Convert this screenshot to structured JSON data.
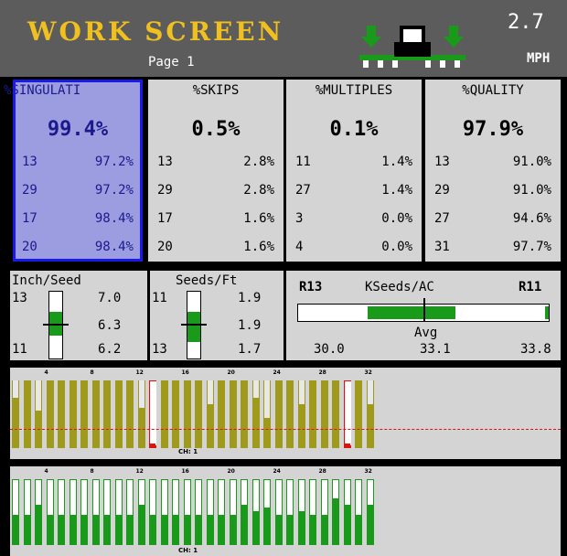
{
  "header": {
    "title": "WORK SCREEN",
    "page": "Page 1",
    "speed_value": "2.7",
    "speed_unit": "MPH",
    "tractor_icon": "tractor-planter-icon"
  },
  "metrics": [
    {
      "key": "singulation",
      "title": "%SINGULATI",
      "value": "99.4%",
      "rows": [
        [
          "13",
          "97.2%"
        ],
        [
          "29",
          "97.2%"
        ],
        [
          "17",
          "98.4%"
        ],
        [
          "20",
          "98.4%"
        ]
      ]
    },
    {
      "key": "skips",
      "title": "%SKIPS",
      "value": "0.5%",
      "rows": [
        [
          "13",
          "2.8%"
        ],
        [
          "29",
          "2.8%"
        ],
        [
          "17",
          "1.6%"
        ],
        [
          "20",
          "1.6%"
        ]
      ]
    },
    {
      "key": "multiples",
      "title": "%MULTIPLES",
      "value": "0.1%",
      "rows": [
        [
          "11",
          "1.4%"
        ],
        [
          "27",
          "1.4%"
        ],
        [
          "3",
          "0.0%"
        ],
        [
          "4",
          "0.0%"
        ]
      ]
    },
    {
      "key": "quality",
      "title": "%QUALITY",
      "value": "97.9%",
      "rows": [
        [
          "13",
          "91.0%"
        ],
        [
          "29",
          "91.0%"
        ],
        [
          "27",
          "94.6%"
        ],
        [
          "31",
          "97.7%"
        ]
      ]
    }
  ],
  "inch_seed": {
    "title": "Inch/Seed",
    "top_row": "13",
    "top_val": "7.0",
    "mid_val": "6.3",
    "bot_row": "11",
    "bot_val": "6.2",
    "fill_level": 0.35
  },
  "seeds_ft": {
    "title": "Seeds/Ft",
    "top_row": "11",
    "top_val": "1.9",
    "mid_val": "1.9",
    "bot_row": "13",
    "bot_val": "1.7",
    "fill_level": 0.45
  },
  "kseeds": {
    "left_row": "R13",
    "title": "KSeeds/AC",
    "right_row": "R11",
    "avg_label": "Avg",
    "min": "30.0",
    "avg": "33.1",
    "max": "33.8"
  },
  "strip_labels": [
    "4",
    "8",
    "12",
    "16",
    "20",
    "24",
    "28",
    "32"
  ],
  "ch_label": "CH: 1",
  "colors": {
    "header_bg": "#5c5c5c",
    "title": "#f0c020",
    "panel": "#d4d4d4",
    "sing_highlight": "#9c9ce0",
    "olive": "#a09a1c",
    "green": "#1a9a1a",
    "alert": "#e01010"
  },
  "strip1_rows": [
    {
      "h": 0.25,
      "alert": false
    },
    {
      "h": 0.0,
      "alert": false
    },
    {
      "h": 0.45,
      "alert": false
    },
    {
      "h": 0.0,
      "alert": false
    },
    {
      "h": 0.0,
      "alert": false
    },
    {
      "h": 0.0,
      "alert": false
    },
    {
      "h": 0.0,
      "alert": false
    },
    {
      "h": 0.0,
      "alert": false
    },
    {
      "h": 0.0,
      "alert": false
    },
    {
      "h": 0.0,
      "alert": false
    },
    {
      "h": 0.0,
      "alert": false
    },
    {
      "h": 0.4,
      "alert": false
    },
    {
      "h": 0.95,
      "alert": true
    },
    {
      "h": 0.0,
      "alert": false
    },
    {
      "h": 0.0,
      "alert": false
    },
    {
      "h": 0.0,
      "alert": false
    },
    {
      "h": 0.0,
      "alert": false
    },
    {
      "h": 0.35,
      "alert": false
    },
    {
      "h": 0.0,
      "alert": false
    },
    {
      "h": 0.0,
      "alert": false
    },
    {
      "h": 0.0,
      "alert": false
    },
    {
      "h": 0.25,
      "alert": false
    },
    {
      "h": 0.55,
      "alert": false
    },
    {
      "h": 0.0,
      "alert": false
    },
    {
      "h": 0.0,
      "alert": false
    },
    {
      "h": 0.35,
      "alert": false
    },
    {
      "h": 0.0,
      "alert": false
    },
    {
      "h": 0.0,
      "alert": false
    },
    {
      "h": 0.0,
      "alert": false
    },
    {
      "h": 0.95,
      "alert": true
    },
    {
      "h": 0.0,
      "alert": false
    },
    {
      "h": 0.35,
      "alert": false
    }
  ],
  "strip2_rows": [
    {
      "h": 0.45
    },
    {
      "h": 0.45
    },
    {
      "h": 0.6
    },
    {
      "h": 0.45
    },
    {
      "h": 0.45
    },
    {
      "h": 0.45
    },
    {
      "h": 0.45
    },
    {
      "h": 0.45
    },
    {
      "h": 0.45
    },
    {
      "h": 0.45
    },
    {
      "h": 0.45
    },
    {
      "h": 0.6
    },
    {
      "h": 0.45
    },
    {
      "h": 0.45
    },
    {
      "h": 0.45
    },
    {
      "h": 0.45
    },
    {
      "h": 0.45
    },
    {
      "h": 0.45
    },
    {
      "h": 0.45
    },
    {
      "h": 0.45
    },
    {
      "h": 0.6
    },
    {
      "h": 0.5
    },
    {
      "h": 0.55
    },
    {
      "h": 0.45
    },
    {
      "h": 0.45
    },
    {
      "h": 0.5
    },
    {
      "h": 0.45
    },
    {
      "h": 0.45
    },
    {
      "h": 0.7
    },
    {
      "h": 0.6
    },
    {
      "h": 0.45
    },
    {
      "h": 0.6
    }
  ]
}
